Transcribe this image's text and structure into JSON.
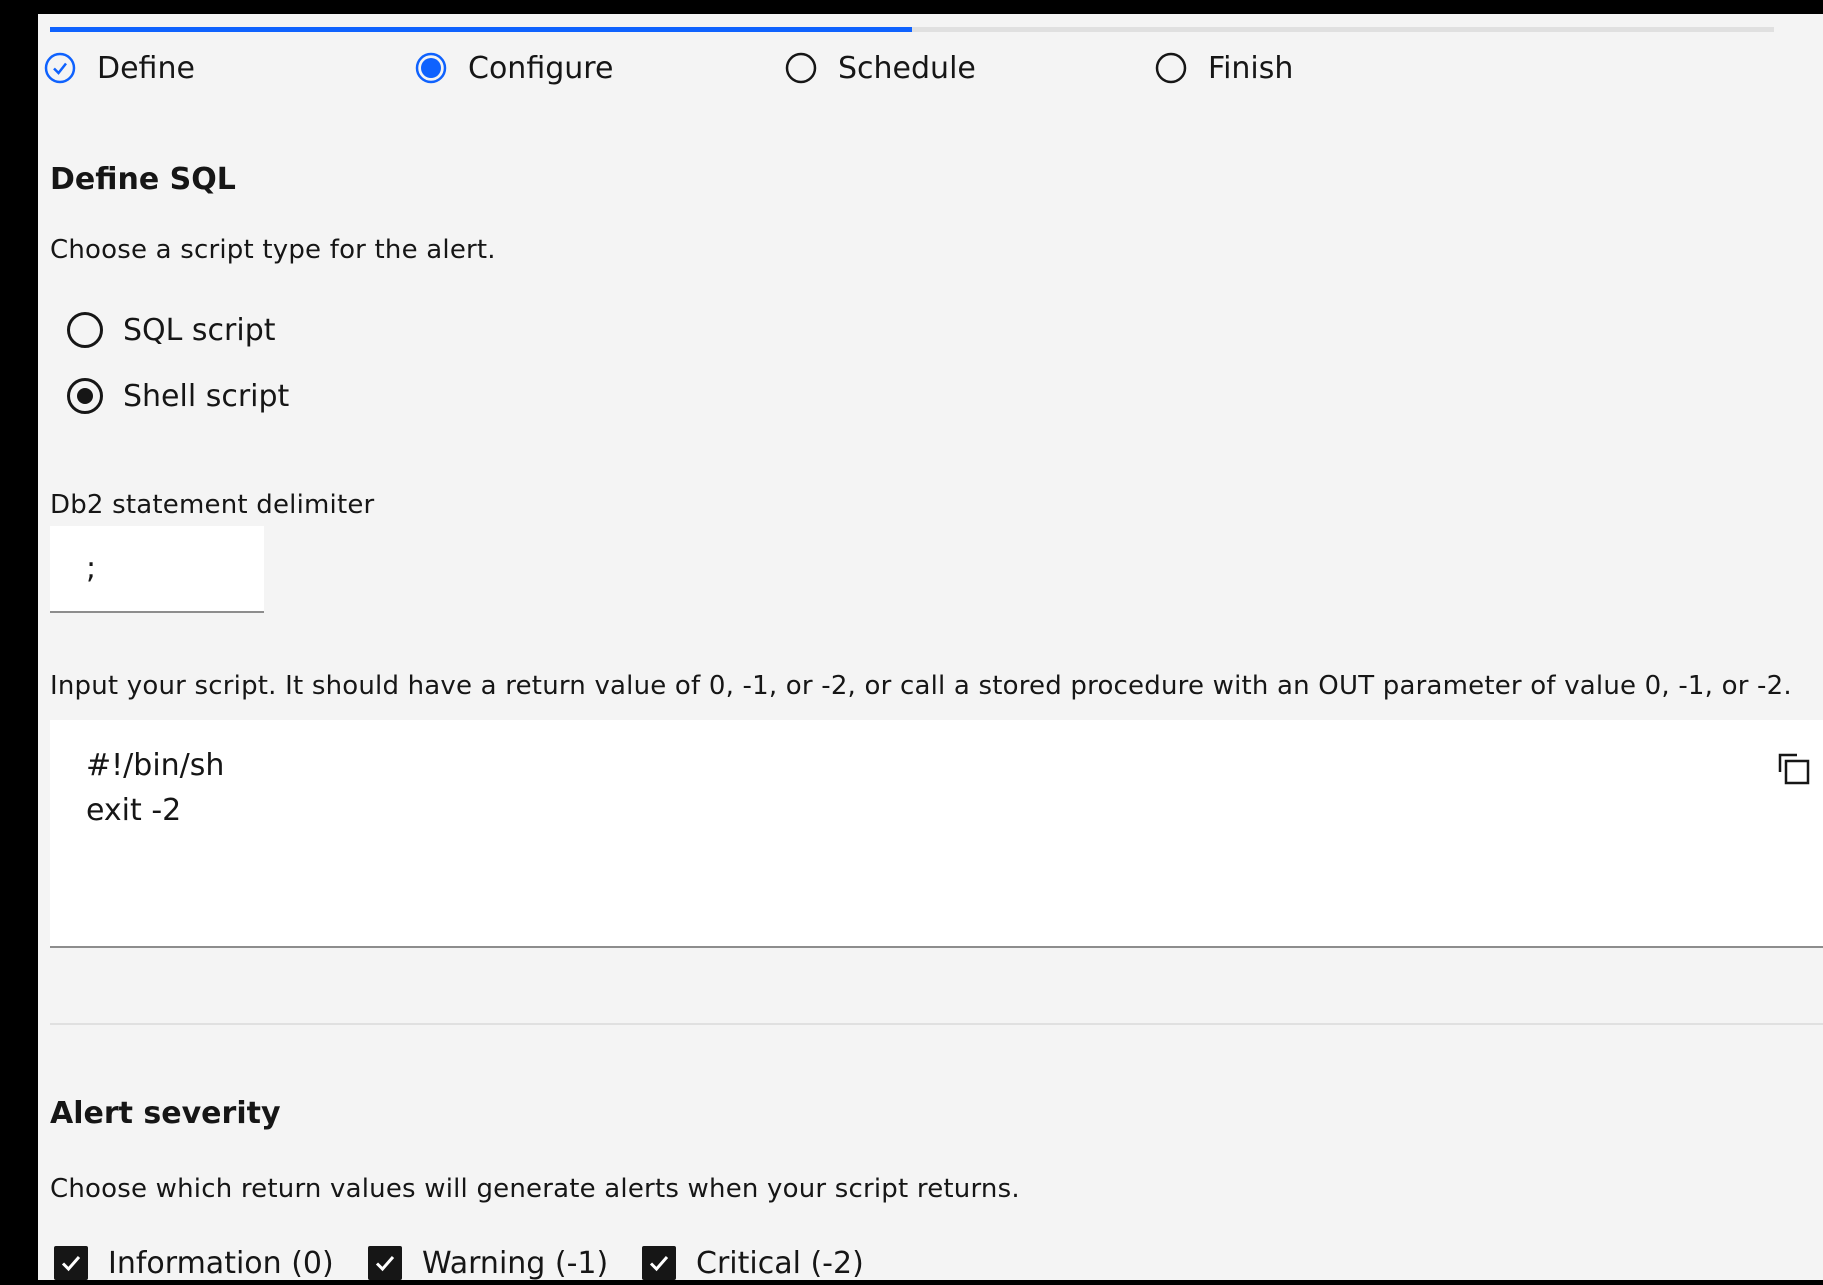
{
  "wizard": {
    "progress_fraction": 0.5,
    "steps": [
      {
        "label": "Define",
        "state": "complete"
      },
      {
        "label": "Configure",
        "state": "current"
      },
      {
        "label": "Schedule",
        "state": "incomplete"
      },
      {
        "label": "Finish",
        "state": "incomplete"
      }
    ]
  },
  "define_sql": {
    "title": "Define SQL",
    "helper": "Choose a script type for the alert.",
    "options": [
      {
        "label": "SQL script",
        "selected": false
      },
      {
        "label": "Shell script",
        "selected": true
      }
    ]
  },
  "delimiter": {
    "label": "Db2 statement delimiter",
    "value": ";"
  },
  "script": {
    "helper": "Input your script. It should have a return value of 0, -1, or -2, or call a stored procedure with an OUT parameter of value 0, -1, or -2.",
    "lines": [
      "#!/bin/sh",
      "exit -2"
    ],
    "copy_icon": "copy-icon"
  },
  "severity": {
    "title": "Alert severity",
    "helper": "Choose which return values will generate alerts when your script returns.",
    "options": [
      {
        "label": "Information (0)",
        "checked": true
      },
      {
        "label": "Warning (-1)",
        "checked": true
      },
      {
        "label": "Critical (-2)",
        "checked": true
      }
    ]
  },
  "colors": {
    "accent": "#0f62fe",
    "background": "#f4f4f4",
    "text": "#161616"
  }
}
